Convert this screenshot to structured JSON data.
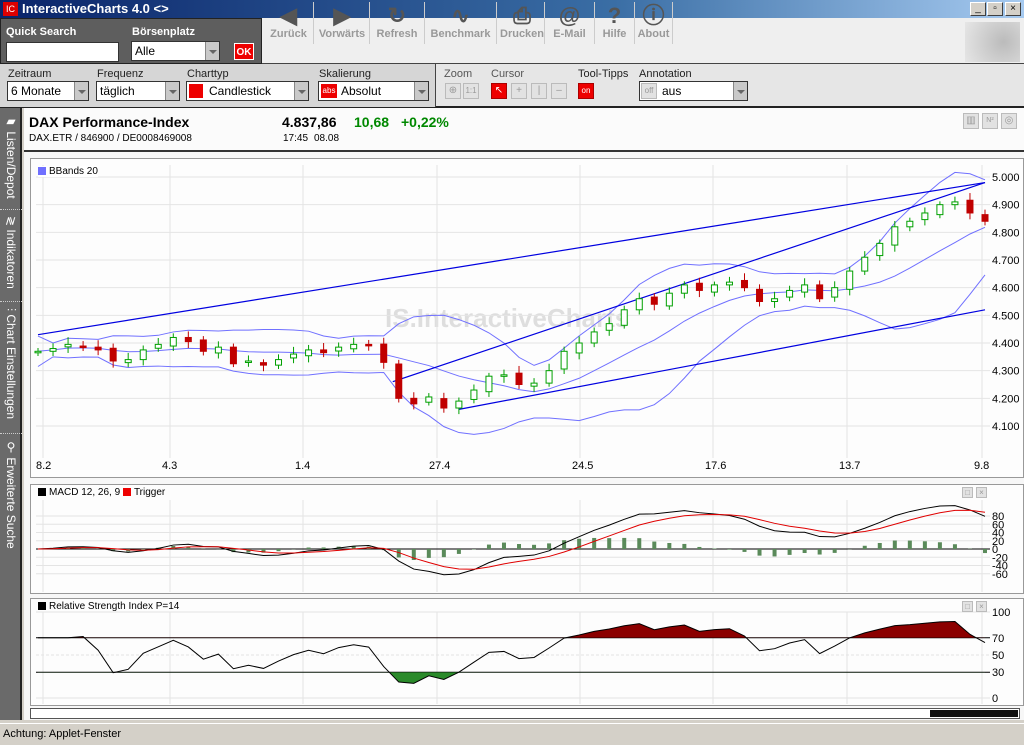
{
  "window": {
    "title": "InteractiveCharts 4.0  <>",
    "logo": "IC",
    "buttons": [
      "_",
      "▫",
      "×"
    ]
  },
  "search": {
    "quick_label": "Quick Search",
    "quick_value": "",
    "boersen_label": "Börsenplatz",
    "boersen_value": "Alle",
    "ok": "OK"
  },
  "toolbar": [
    {
      "label": "Zurück",
      "icon": "◀"
    },
    {
      "label": "Vorwärts",
      "icon": "▶"
    },
    {
      "label": "Refresh",
      "icon": "↻"
    },
    {
      "label": "Benchmark",
      "icon": "∿"
    },
    {
      "label": "Drucken",
      "icon": "⎙"
    },
    {
      "label": "E-Mail",
      "icon": "@"
    },
    {
      "label": "Hilfe",
      "icon": "?"
    },
    {
      "label": "About",
      "icon": "ⓘ"
    }
  ],
  "settings": {
    "zeitraum_label": "Zeitraum",
    "zeitraum": "6 Monate",
    "frequenz_label": "Frequenz",
    "frequenz": "täglich",
    "charttyp_label": "Charttyp",
    "charttyp": "Candlestick",
    "skal_label": "Skalierung",
    "skal": "Absolut",
    "skal_icon": "abs",
    "zoom_label": "Zoom",
    "zoom_11": "1:1",
    "cursor_label": "Cursor",
    "tooltips_label": "Tool-Tipps",
    "tooltips": "on",
    "annotation_label": "Annotation",
    "annotation_off": "off",
    "annotation": "aus"
  },
  "sidebar": [
    "Listen/Depot",
    "Indikatoren",
    "Chart Einstellungen",
    "Erweiterte Suche"
  ],
  "instrument": {
    "name": "DAX Performance-Index",
    "ids": "DAX.ETR  /  846900  /  DE0008469008",
    "price": "4.837,86",
    "change": "10,68",
    "change_pct": "+0,22%",
    "time": "17:45",
    "date": "08.08"
  },
  "watermark": "IS.InteractiveCharts",
  "status": "Achtung: Applet-Fenster",
  "colors": {
    "up": "#00a000",
    "down": "#c00000",
    "bands": "#7070ff",
    "trend": "#0000e0",
    "macd": "#000000",
    "trigger": "#e00000",
    "rsi_fill": "#8b0000"
  },
  "chart_data": [
    {
      "type": "candlestick",
      "legend": "BBands 20",
      "ylim": [
        4100,
        5000
      ],
      "yticks": [
        "5.000",
        "4.900",
        "4.800",
        "4.700",
        "4.600",
        "4.500",
        "4.400",
        "4.300",
        "4.200",
        "4.100"
      ],
      "xticks": [
        "8.2",
        "4.3",
        "1.4",
        "27.4",
        "24.5",
        "17.6",
        "13.7",
        "9.8"
      ],
      "closes": [
        4370,
        4380,
        4395,
        4385,
        4375,
        4335,
        4340,
        4375,
        4395,
        4420,
        4405,
        4370,
        4385,
        4325,
        4335,
        4320,
        4340,
        4360,
        4375,
        4365,
        4385,
        4395,
        4390,
        4330,
        4200,
        4180,
        4205,
        4165,
        4190,
        4230,
        4280,
        4285,
        4250,
        4255,
        4300,
        4370,
        4400,
        4440,
        4470,
        4520,
        4560,
        4540,
        4580,
        4610,
        4590,
        4610,
        4620,
        4600,
        4550,
        4560,
        4590,
        4610,
        4560,
        4600,
        4660,
        4710,
        4760,
        4820,
        4840,
        4870,
        4900,
        4910,
        4870,
        4840
      ],
      "trendlines": [
        [
          0,
          4430,
          63,
          4980
        ],
        [
          23.6,
          4260,
          63,
          4980
        ],
        [
          28,
          4160,
          63,
          4520
        ]
      ]
    },
    {
      "type": "line",
      "legend": [
        "MACD 12, 26, 9",
        "Trigger"
      ],
      "ylim": [
        -70,
        90
      ],
      "yticks": [
        "80",
        "60",
        "40",
        "20",
        "0",
        "-20",
        "-40",
        "-60"
      ]
    },
    {
      "type": "line",
      "legend": "Relative Strength Index P=14",
      "ylim": [
        0,
        100
      ],
      "yticks": [
        "100",
        "70",
        "50",
        "30",
        "0"
      ]
    }
  ]
}
